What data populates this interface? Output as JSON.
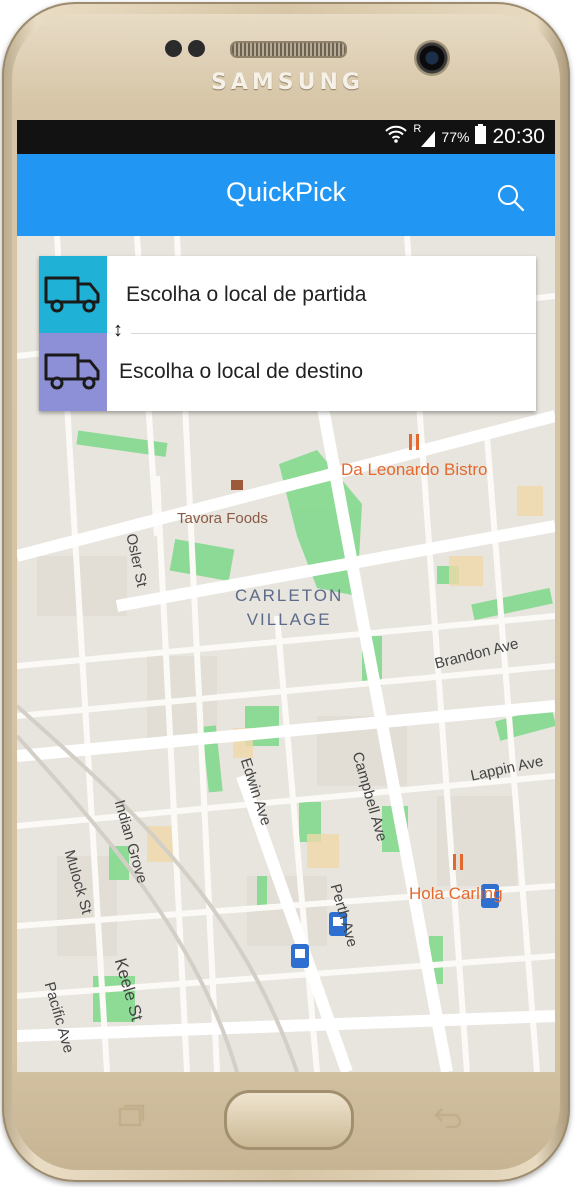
{
  "device": {
    "brand": "SAMSUNG"
  },
  "status_bar": {
    "network_badge": "R",
    "battery_percent": "77%",
    "time": "20:30"
  },
  "app_bar": {
    "title": "QuickPick",
    "search_icon": "search-icon"
  },
  "route_card": {
    "origin_placeholder": "Escolha o local de partida",
    "destination_placeholder": "Escolha o local de destino",
    "swap_glyph": "↕",
    "origin_icon": "truck-icon",
    "destination_icon": "truck-icon",
    "origin_color": "#1fb1d6",
    "destination_color": "#8d8fd7"
  },
  "map": {
    "pois": [
      "Da Leonardo Bistro",
      "Tavora Foods",
      "Hola Carling"
    ],
    "area_label": [
      "CARLETON",
      "VILLAGE"
    ],
    "streets": [
      "Osler St",
      "Brandon Ave",
      "Lappin Ave",
      "Edwin Ave",
      "Campbell Ave",
      "Perth Ave",
      "Indian Grove",
      "Mulock St",
      "Keele St",
      "Pacific Ave"
    ]
  },
  "colors": {
    "app_bar": "#2196f3",
    "poi": "#e36a2f",
    "park": "#7ed98a"
  }
}
